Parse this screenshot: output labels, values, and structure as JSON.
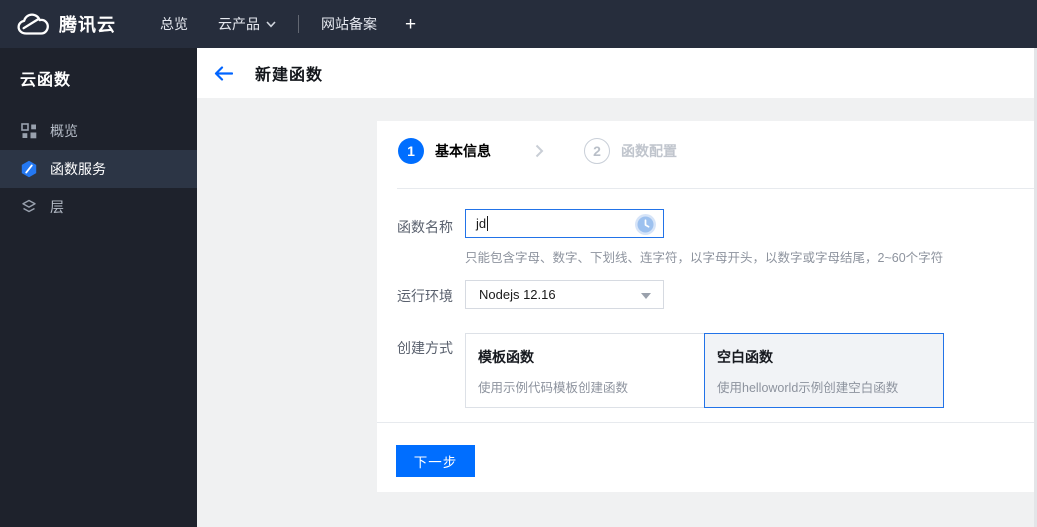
{
  "navbar": {
    "logo_text": "腾讯云",
    "overview_label": "总览",
    "products_label": "云产品",
    "beian_label": "网站备案",
    "plus_label": "+"
  },
  "sidebar": {
    "title": "云函数",
    "items": [
      {
        "label": "概览",
        "icon": "grid-icon",
        "selected": false
      },
      {
        "label": "函数服务",
        "icon": "function-hexagon-icon",
        "selected": true
      },
      {
        "label": "层",
        "icon": "layers-icon",
        "selected": false
      }
    ]
  },
  "header": {
    "title": "新建函数"
  },
  "wizard": {
    "step1_number": "1",
    "step1_label": "基本信息",
    "step2_number": "2",
    "step2_label": "函数配置"
  },
  "form": {
    "name_label": "函数名称",
    "name_value": "jd",
    "name_hint": "只能包含字母、数字、下划线、连字符，以字母开头，以数字或字母结尾，2~60个字符",
    "runtime_label": "运行环境",
    "runtime_value": "Nodejs 12.16",
    "method_label": "创建方式",
    "options": [
      {
        "title": "模板函数",
        "desc": "使用示例代码模板创建函数",
        "selected": false
      },
      {
        "title": "空白函数",
        "desc": "使用helloworld示例创建空白函数",
        "selected": true
      }
    ]
  },
  "footer": {
    "next_label": "下一步"
  },
  "colors": {
    "accent": "#006eff",
    "navbar_bg": "#262d3c",
    "sidebar_bg": "#1e222c",
    "sidebar_selected_bg": "#2c3545",
    "selected_card_border": "#2273e8"
  }
}
